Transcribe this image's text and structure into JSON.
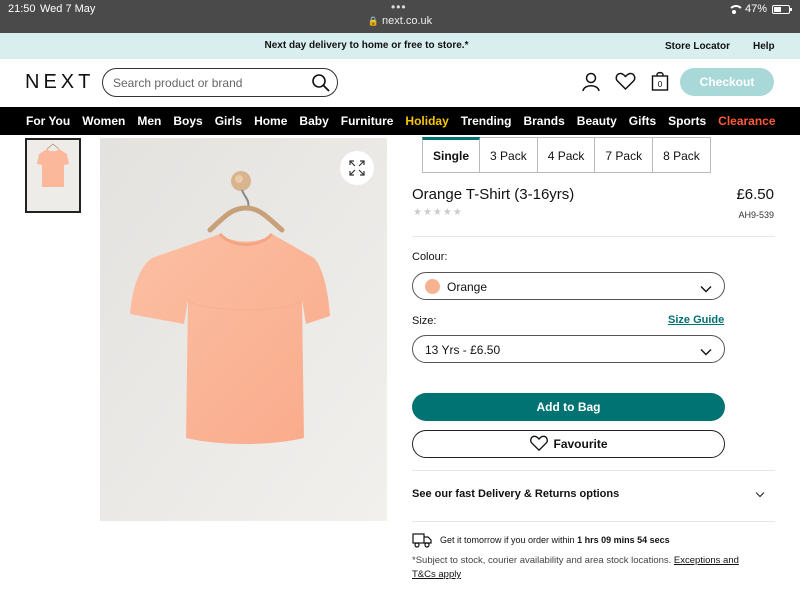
{
  "status": {
    "time": "21:50",
    "date": "Wed 7 May",
    "url": "next.co.uk",
    "battery": "47%",
    "battery_level": 0.47
  },
  "promo": {
    "message": "Next day delivery to home or free to store.*",
    "store_locator": "Store Locator",
    "help": "Help"
  },
  "header": {
    "logo": "NEXT",
    "search_placeholder": "Search product or brand",
    "bag_count": "0",
    "checkout": "Checkout"
  },
  "nav": {
    "items": [
      "For You",
      "Women",
      "Men",
      "Boys",
      "Girls",
      "Home",
      "Baby",
      "Furniture",
      "Holiday",
      "Trending",
      "Brands",
      "Beauty",
      "Gifts",
      "Sports",
      "Clearance"
    ]
  },
  "product": {
    "packs": [
      "Single",
      "3 Pack",
      "4 Pack",
      "7 Pack",
      "8 Pack"
    ],
    "selected_pack": "Single",
    "title": "Orange T-Shirt (3-16yrs)",
    "price": "£6.50",
    "sku": "AH9-539",
    "rating_stars": 0,
    "colour_label": "Colour:",
    "colour_value": "Orange",
    "colour_swatch": "#f7b291",
    "size_label": "Size:",
    "size_guide": "Size Guide",
    "size_value": "13 Yrs - £6.50",
    "add_to_bag": "Add to Bag",
    "favourite": "Favourite",
    "delivery_options": "See our fast Delivery & Returns options",
    "get_it_prefix": "Get it tomorrow if you order within",
    "countdown": "1 hrs 09 mins 54 secs",
    "subject_text": "*Subject to stock, courier availability and area stock locations.",
    "exceptions_link": "Exceptions and T&Cs apply"
  },
  "colors": {
    "accent": "#007372",
    "checkout_disabled": "#a9d8d8",
    "promo_bg": "#d9efef",
    "holiday": "#f6c700",
    "clearance": "#ff5a3a"
  }
}
